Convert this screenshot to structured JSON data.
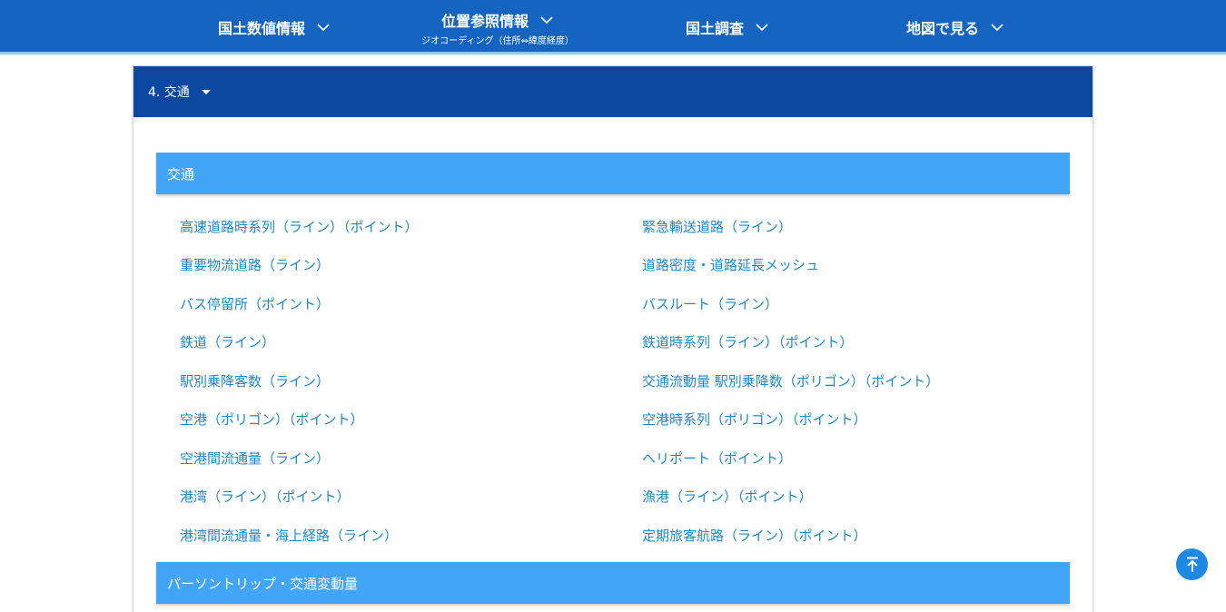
{
  "nav": {
    "items": [
      {
        "label": "国土数値情報"
      },
      {
        "label": "位置参照情報",
        "sub": "ジオコーディング（住所⇔緯度経度）"
      },
      {
        "label": "国土調査"
      },
      {
        "label": "地図で見る"
      }
    ]
  },
  "card": {
    "title": "4. 交通"
  },
  "sections": [
    {
      "label": "交通"
    },
    {
      "label": "パーソントリップ・交通変動量"
    }
  ],
  "links": [
    [
      "高速道路時系列（ライン）（ポイント）",
      "緊急輸送道路（ライン）"
    ],
    [
      "重要物流道路（ライン）",
      "道路密度・道路延長メッシュ"
    ],
    [
      "バス停留所（ポイント）",
      "バスルート（ライン）"
    ],
    [
      "鉄道（ライン）",
      "鉄道時系列（ライン）（ポイント）"
    ],
    [
      "駅別乗降客数（ライン）",
      "交通流動量 駅別乗降数（ポリゴン）（ポイント）"
    ],
    [
      "空港（ポリゴン）（ポイント）",
      "空港時系列（ポリゴン）（ポイント）"
    ],
    [
      "空港間流通量（ライン）",
      "ヘリポート（ポイント）"
    ],
    [
      "港湾（ライン）（ポイント）",
      "漁港（ライン）（ポイント）"
    ],
    [
      "港湾間流通量・海上経路（ライン）",
      "定期旅客航路（ライン）（ポイント）"
    ]
  ],
  "icons": {
    "nav_chevron": "chevron-down-icon",
    "card_caret": "caret-down-icon",
    "scroll_top": "arrow-up-to-line-icon"
  },
  "colors": {
    "nav_bg": "#1565c0",
    "card_header_bg": "#0d47a1",
    "section_bg": "#42a5f5",
    "link": "#1e88c8",
    "top_button": "#1e88e5"
  }
}
